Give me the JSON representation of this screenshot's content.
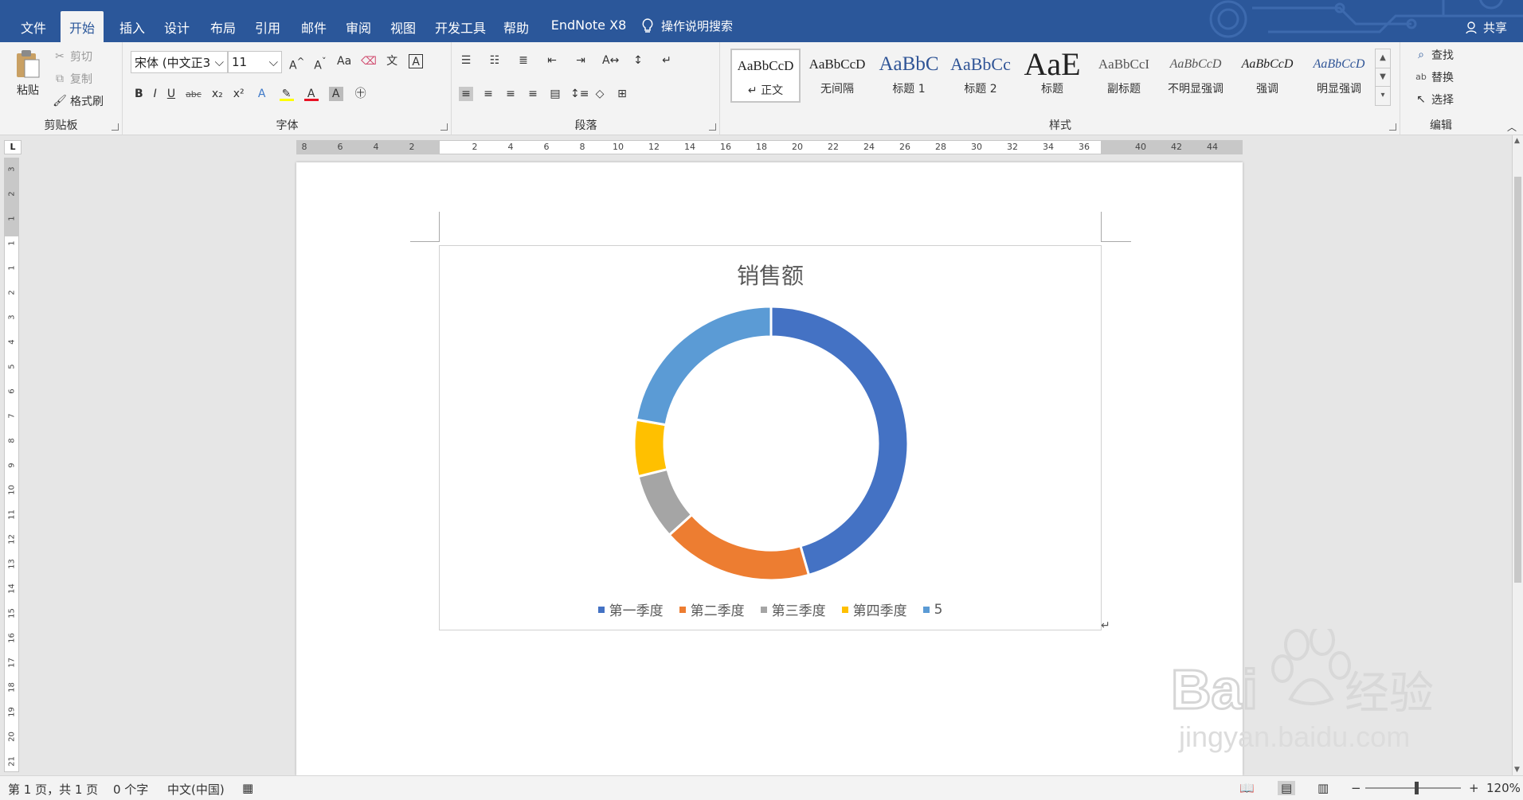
{
  "ribbon_tabs": [
    "文件",
    "开始",
    "插入",
    "设计",
    "布局",
    "引用",
    "邮件",
    "审阅",
    "视图",
    "开发工具",
    "帮助",
    "EndNote X8"
  ],
  "active_tab": "开始",
  "tell_me": "操作说明搜索",
  "share": "共享",
  "clipboard": {
    "paste": "粘贴",
    "cut": "剪切",
    "copy": "复制",
    "format_painter": "格式刷",
    "label": "剪贴板"
  },
  "font": {
    "name": "宋体 (中文正3",
    "size": "11",
    "label": "字体",
    "change_case": "Aa",
    "bold": "B",
    "italic": "I",
    "underline": "U",
    "strike": "abc",
    "subscript": "x₂",
    "superscript": "x²"
  },
  "paragraph": {
    "label": "段落"
  },
  "styles": {
    "label": "样式",
    "items": [
      {
        "preview": "AaBbCcD",
        "name": "↵ 正文"
      },
      {
        "preview": "AaBbCcD",
        "name": "无间隔"
      },
      {
        "preview": "AaBbC",
        "name": "标题 1"
      },
      {
        "preview": "AaBbCc",
        "name": "标题 2"
      },
      {
        "preview": "AaE",
        "name": "标题"
      },
      {
        "preview": "AaBbCcI",
        "name": "副标题"
      },
      {
        "preview": "AaBbCcD",
        "name": "不明显强调"
      },
      {
        "preview": "AaBbCcD",
        "name": "强调"
      },
      {
        "preview": "AaBbCcD",
        "name": "明显强调"
      }
    ]
  },
  "editing": {
    "find": "查找",
    "replace": "替换",
    "select": "选择",
    "label": "编辑"
  },
  "ruler": {
    "horizontal": [
      "8",
      "6",
      "4",
      "2",
      "2",
      "4",
      "6",
      "8",
      "10",
      "12",
      "14",
      "16",
      "18",
      "20",
      "22",
      "24",
      "26",
      "28",
      "30",
      "32",
      "34",
      "36",
      "40",
      "42",
      "44"
    ],
    "vertical": [
      "3",
      "2",
      "1",
      "1",
      "1",
      "2",
      "3",
      "4",
      "5",
      "6",
      "7",
      "8",
      "9",
      "10",
      "11",
      "12",
      "13",
      "14",
      "15",
      "16",
      "17",
      "18",
      "19",
      "20",
      "21"
    ]
  },
  "chart_data": {
    "type": "pie",
    "variant": "doughnut",
    "title": "销售额",
    "categories": [
      "第一季度",
      "第二季度",
      "第三季度",
      "第四季度",
      "5"
    ],
    "values": [
      8.2,
      3.2,
      1.4,
      1.2,
      4.0
    ],
    "colors": [
      "#4472c4",
      "#ed7d31",
      "#a5a5a5",
      "#ffc000",
      "#5b9bd5"
    ],
    "legend_position": "bottom"
  },
  "status": {
    "page": "第 1 页，共 1 页",
    "words": "0 个字",
    "language": "中文(中国)",
    "zoom": "120%"
  },
  "watermark": {
    "line1": "Baidu经验",
    "line2": "jingyan.baidu.com"
  }
}
